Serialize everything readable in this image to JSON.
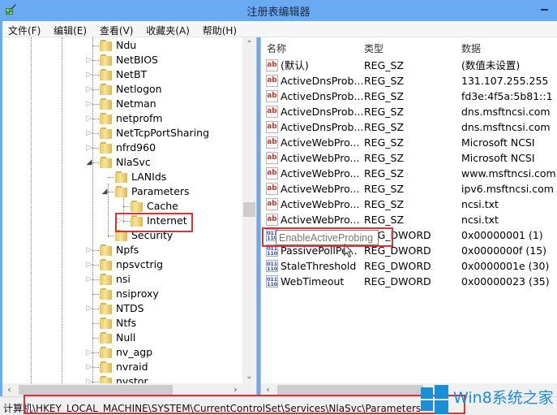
{
  "window": {
    "title": "注册表编辑器",
    "app_icon": "regedit-icon",
    "minimize_icon": "minimize-icon"
  },
  "menu": [
    {
      "label": "文件(F)"
    },
    {
      "label": "编辑(E)"
    },
    {
      "label": "查看(V)"
    },
    {
      "label": "收藏夹(A)"
    },
    {
      "label": "帮助(H)"
    }
  ],
  "tree": {
    "items": [
      {
        "label": "Ndu",
        "level": 0,
        "expander": "none"
      },
      {
        "label": "NetBIOS",
        "level": 0,
        "expander": "collapsed"
      },
      {
        "label": "NetBT",
        "level": 0,
        "expander": "collapsed"
      },
      {
        "label": "Netlogon",
        "level": 0,
        "expander": "collapsed"
      },
      {
        "label": "Netman",
        "level": 0,
        "expander": "collapsed"
      },
      {
        "label": "netprofm",
        "level": 0,
        "expander": "collapsed"
      },
      {
        "label": "NetTcpPortSharing",
        "level": 0,
        "expander": "collapsed"
      },
      {
        "label": "nfrd960",
        "level": 0,
        "expander": "collapsed"
      },
      {
        "label": "NlaSvc",
        "level": 0,
        "expander": "expanded"
      },
      {
        "label": "LANIds",
        "level": 1,
        "expander": "none"
      },
      {
        "label": "Parameters",
        "level": 1,
        "expander": "expanded"
      },
      {
        "label": "Cache",
        "level": 2,
        "expander": "none"
      },
      {
        "label": "Internet",
        "level": 2,
        "expander": "collapsed",
        "highlighted": true
      },
      {
        "label": "Security",
        "level": 1,
        "expander": "none"
      },
      {
        "label": "Npfs",
        "level": 0,
        "expander": "collapsed"
      },
      {
        "label": "npsvctrig",
        "level": 0,
        "expander": "collapsed"
      },
      {
        "label": "nsi",
        "level": 0,
        "expander": "collapsed"
      },
      {
        "label": "nsiproxy",
        "level": 0,
        "expander": "none"
      },
      {
        "label": "NTDS",
        "level": 0,
        "expander": "collapsed"
      },
      {
        "label": "Ntfs",
        "level": 0,
        "expander": "none"
      },
      {
        "label": "Null",
        "level": 0,
        "expander": "none"
      },
      {
        "label": "nv_agp",
        "level": 0,
        "expander": "collapsed"
      },
      {
        "label": "nvraid",
        "level": 0,
        "expander": "collapsed"
      },
      {
        "label": "nvstor",
        "level": 0,
        "expander": "collapsed"
      }
    ]
  },
  "list": {
    "columns": [
      "名称",
      "类型",
      "数据"
    ],
    "rows": [
      {
        "icon": "string-value-icon",
        "name": "(默认)",
        "type": "REG_SZ",
        "data": "(数值未设置)"
      },
      {
        "icon": "string-value-icon",
        "name": "ActiveDnsProb...",
        "type": "REG_SZ",
        "data": "131.107.255.255"
      },
      {
        "icon": "string-value-icon",
        "name": "ActiveDnsProb...",
        "type": "REG_SZ",
        "data": "fd3e:4f5a:5b81::1"
      },
      {
        "icon": "string-value-icon",
        "name": "ActiveDnsProb...",
        "type": "REG_SZ",
        "data": "dns.msftncsi.com"
      },
      {
        "icon": "string-value-icon",
        "name": "ActiveDnsProb...",
        "type": "REG_SZ",
        "data": "dns.msftncsi.com"
      },
      {
        "icon": "string-value-icon",
        "name": "ActiveWebPro...",
        "type": "REG_SZ",
        "data": "Microsoft NCSI"
      },
      {
        "icon": "string-value-icon",
        "name": "ActiveWebPro...",
        "type": "REG_SZ",
        "data": "Microsoft NCSI"
      },
      {
        "icon": "string-value-icon",
        "name": "ActiveWebPro...",
        "type": "REG_SZ",
        "data": "www.msftncsi.com"
      },
      {
        "icon": "string-value-icon",
        "name": "ActiveWebPro...",
        "type": "REG_SZ",
        "data": "ipv6.msftncsi.com"
      },
      {
        "icon": "string-value-icon",
        "name": "ActiveWebPro...",
        "type": "REG_SZ",
        "data": "ncsi.txt"
      },
      {
        "icon": "string-value-icon",
        "name": "ActiveWebPro...",
        "type": "REG_SZ",
        "data": "ncsi.txt"
      },
      {
        "icon": "dword-value-icon",
        "name": "",
        "type": "REG_DWORD",
        "data": "0x00000001 (1)",
        "editing": true
      },
      {
        "icon": "dword-value-icon",
        "name": "PassivePollPe...",
        "type": "REG_DWORD",
        "data": "0x0000000f (15)"
      },
      {
        "icon": "dword-value-icon",
        "name": "StaleThreshold",
        "type": "REG_DWORD",
        "data": "0x0000001e (30)"
      },
      {
        "icon": "dword-value-icon",
        "name": "WebTimeout",
        "type": "REG_DWORD",
        "data": "0x00000023 (35)"
      }
    ],
    "rename_value": "EnableActiveProbing"
  },
  "statusbar": {
    "path": "计算机\\HKEY_LOCAL_MACHINE\\SYSTEM\\CurrentControlSet\\Services\\NlaSvc\\Parameters"
  },
  "watermark": {
    "text": "Win8系统之家"
  },
  "colors": {
    "titlebar": "#6aaaf3",
    "highlight": "#d8323b",
    "watermark": "#1a8fd8"
  }
}
